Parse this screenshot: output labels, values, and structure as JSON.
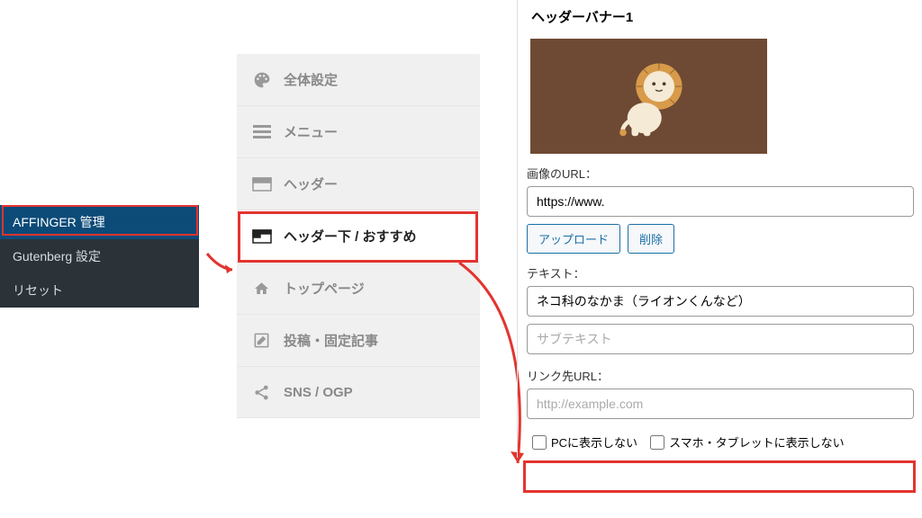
{
  "sidebar": {
    "items": [
      {
        "label": "AFFINGER 管理"
      },
      {
        "label": "Gutenberg 設定"
      },
      {
        "label": "リセット"
      }
    ]
  },
  "menu": {
    "items": [
      {
        "label": "全体設定"
      },
      {
        "label": "メニュー"
      },
      {
        "label": "ヘッダー"
      },
      {
        "label": "ヘッダー下 / おすすめ"
      },
      {
        "label": "トップページ"
      },
      {
        "label": "投稿・固定記事"
      },
      {
        "label": "SNS / OGP"
      }
    ]
  },
  "panel": {
    "title": "ヘッダーバナー1",
    "image_url_label": "画像のURL：",
    "image_url_value": "https://www.",
    "upload_label": "アップロード",
    "delete_label": "削除",
    "text_label": "テキスト：",
    "text_value": "ネコ科のなかま（ライオンくんなど）",
    "subtext_placeholder": "サブテキスト",
    "link_label": "リンク先URL：",
    "link_placeholder": "http://example.com",
    "hide_pc_label": "PCに表示しない",
    "hide_sp_label": "スマホ・タブレットに表示しない"
  }
}
